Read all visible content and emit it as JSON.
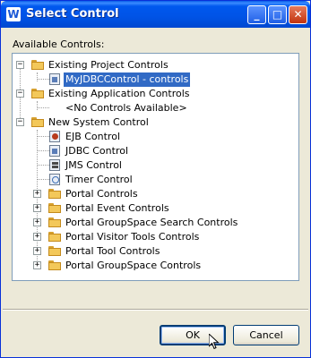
{
  "window": {
    "title": "Select Control",
    "icon": "w-app-icon"
  },
  "title_buttons": {
    "minimize": "_",
    "maximize": "□",
    "close": "✕"
  },
  "label": "Available Controls:",
  "tree": {
    "existing_project": {
      "label": "Existing Project Controls",
      "expanded": true,
      "children": [
        "MyJDBCControl - controls"
      ]
    },
    "existing_app": {
      "label": "Existing Application Controls",
      "expanded": true,
      "children": [
        "<No Controls Available>"
      ]
    },
    "new_system": {
      "label": "New System Control",
      "expanded": true,
      "children": [
        "EJB Control",
        "JDBC Control",
        "JMS Control",
        "Timer Control",
        "Portal Controls",
        "Portal Event Controls",
        "Portal GroupSpace Search Controls",
        "Portal Visitor Tools Controls",
        "Portal Tool Controls",
        "Portal GroupSpace Controls"
      ]
    }
  },
  "buttons": {
    "ok": "OK",
    "cancel": "Cancel"
  }
}
